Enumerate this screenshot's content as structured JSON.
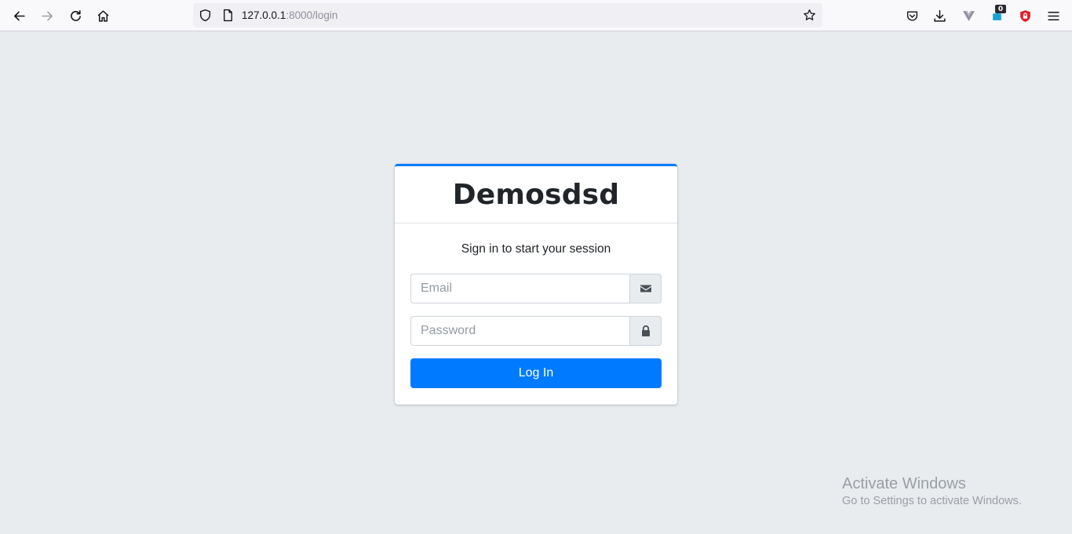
{
  "browser": {
    "url_host": "127.0.0.1",
    "url_path": ":8000/login",
    "extension_badge": "0"
  },
  "login": {
    "brand": "Demosdsd",
    "message": "Sign in to start your session",
    "email_placeholder": "Email",
    "password_placeholder": "Password",
    "submit_label": "Log In"
  },
  "watermark": {
    "title": "Activate Windows",
    "subtitle": "Go to Settings to activate Windows."
  },
  "colors": {
    "accent": "#007bff",
    "page_background": "#e9ecef"
  },
  "icons": {
    "email_addon": "envelope-icon",
    "password_addon": "lock-icon"
  }
}
